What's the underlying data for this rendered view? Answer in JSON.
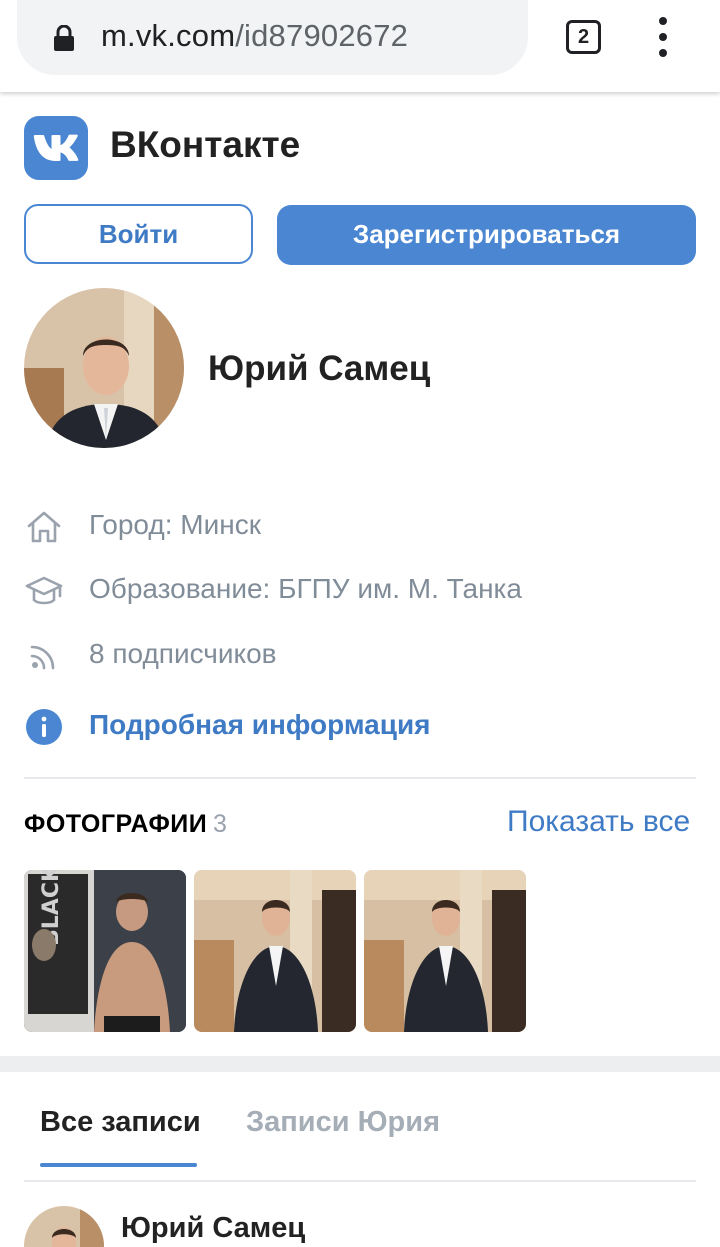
{
  "browser": {
    "url_host": "m.vk.com",
    "url_path": "/id87902672",
    "tab_count": "2"
  },
  "header": {
    "brand": "ВКонтакте"
  },
  "auth": {
    "login_label": "Войти",
    "register_label": "Зарегистрироваться"
  },
  "profile": {
    "name": "Юрий Самец",
    "info": [
      {
        "icon": "home-icon",
        "text": "Город: Минск"
      },
      {
        "icon": "education-icon",
        "text": "Образование: БГПУ им. М. Танка"
      },
      {
        "icon": "rss-icon",
        "text": "8 подписчиков"
      }
    ],
    "more_info_label": "Подробная информация"
  },
  "photos": {
    "title": "ФОТОГРАФИИ",
    "count": "3",
    "show_all_label": "Показать все"
  },
  "tabs": [
    {
      "label": "Все записи",
      "active": true
    },
    {
      "label": "Записи Юрия",
      "active": false
    }
  ],
  "post": {
    "author": "Юрий Самец"
  },
  "colors": {
    "accent": "#4a86d1",
    "link": "#3f7bc5",
    "muted_text": "#818c99"
  }
}
